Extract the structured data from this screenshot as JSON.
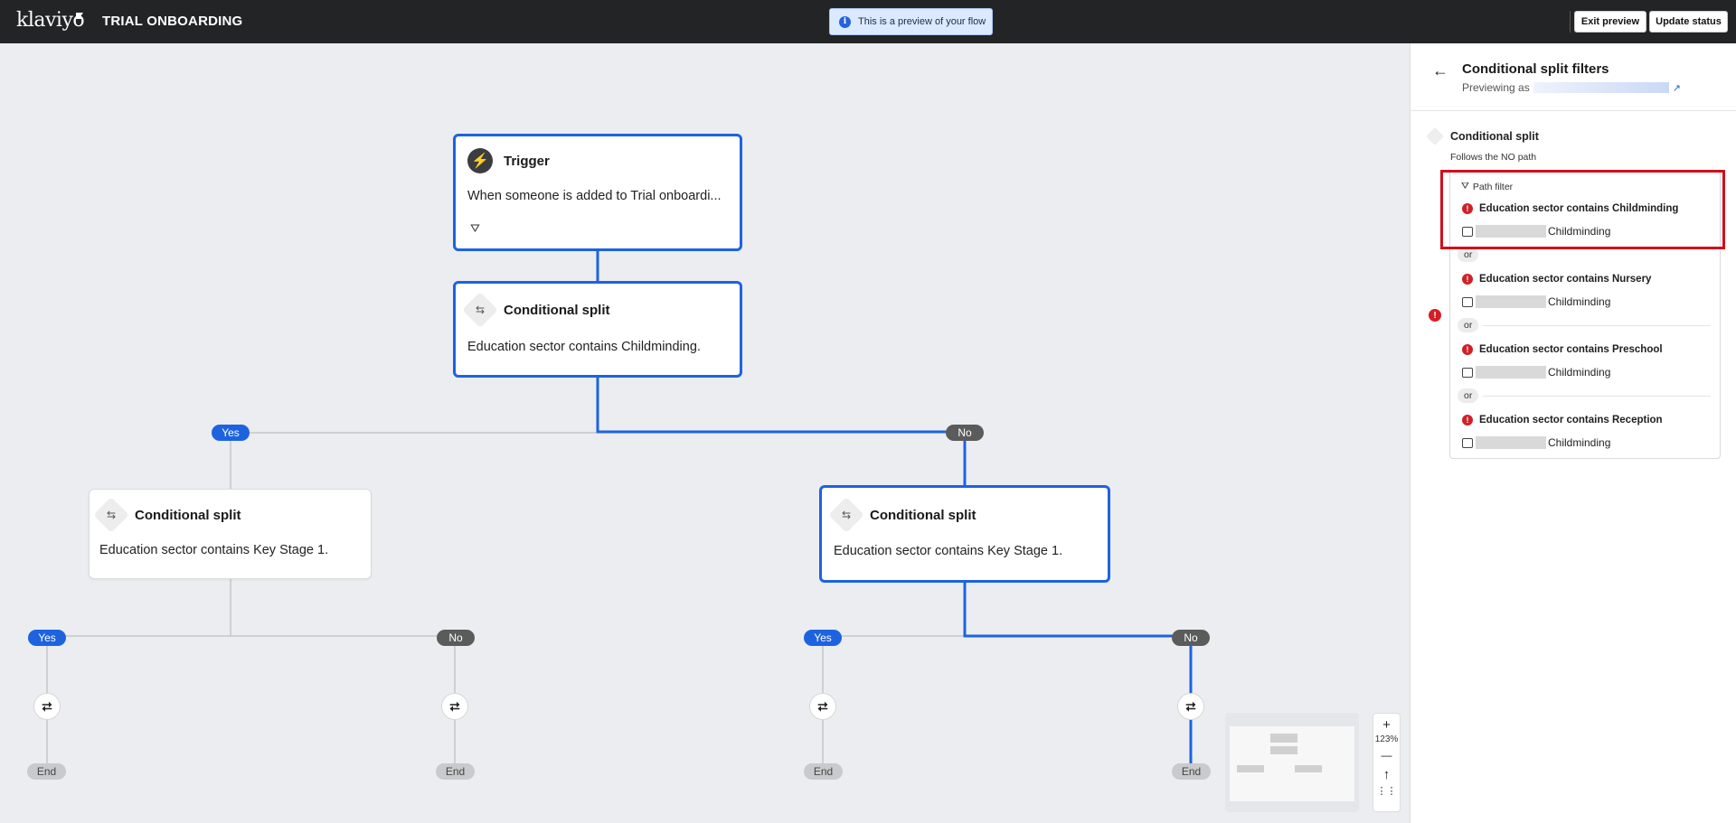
{
  "header": {
    "logo": "klaviyo",
    "flow_title": "TRIAL ONBOARDING",
    "preview_banner": "This is a preview of your flow",
    "exit_preview": "Exit preview",
    "update_status": "Update status"
  },
  "flow": {
    "trigger": {
      "title": "Trigger",
      "description": "When someone is added to Trial onboardi...",
      "icon": "lightning-icon"
    },
    "split_main": {
      "title": "Conditional split",
      "description": "Education sector contains Childminding."
    },
    "split_yes": {
      "title": "Conditional split",
      "description": "Education sector contains Key Stage 1."
    },
    "split_no": {
      "title": "Conditional split",
      "description": "Education sector contains Key Stage 1."
    },
    "labels": {
      "yes": "Yes",
      "no": "No",
      "end": "End"
    }
  },
  "zoom": {
    "plus": "+",
    "level": "123%",
    "minus": "—",
    "up": "↑",
    "grid": "⋮⋮"
  },
  "panel": {
    "title": "Conditional split filters",
    "previewing_as": "Previewing as",
    "split_label": "Conditional split",
    "follows": "Follows the NO path",
    "path_filter": "Path filter",
    "or": "or",
    "conditions": [
      {
        "text": "Education sector contains Childminding",
        "value": "Childminding"
      },
      {
        "text": "Education sector contains Nursery",
        "value": "Childminding"
      },
      {
        "text": "Education sector contains Preschool",
        "value": "Childminding"
      },
      {
        "text": "Education sector contains Reception",
        "value": "Childminding"
      }
    ]
  },
  "colors": {
    "accent": "#1d63e0",
    "alert": "#d21f26",
    "topbar": "#232426"
  }
}
